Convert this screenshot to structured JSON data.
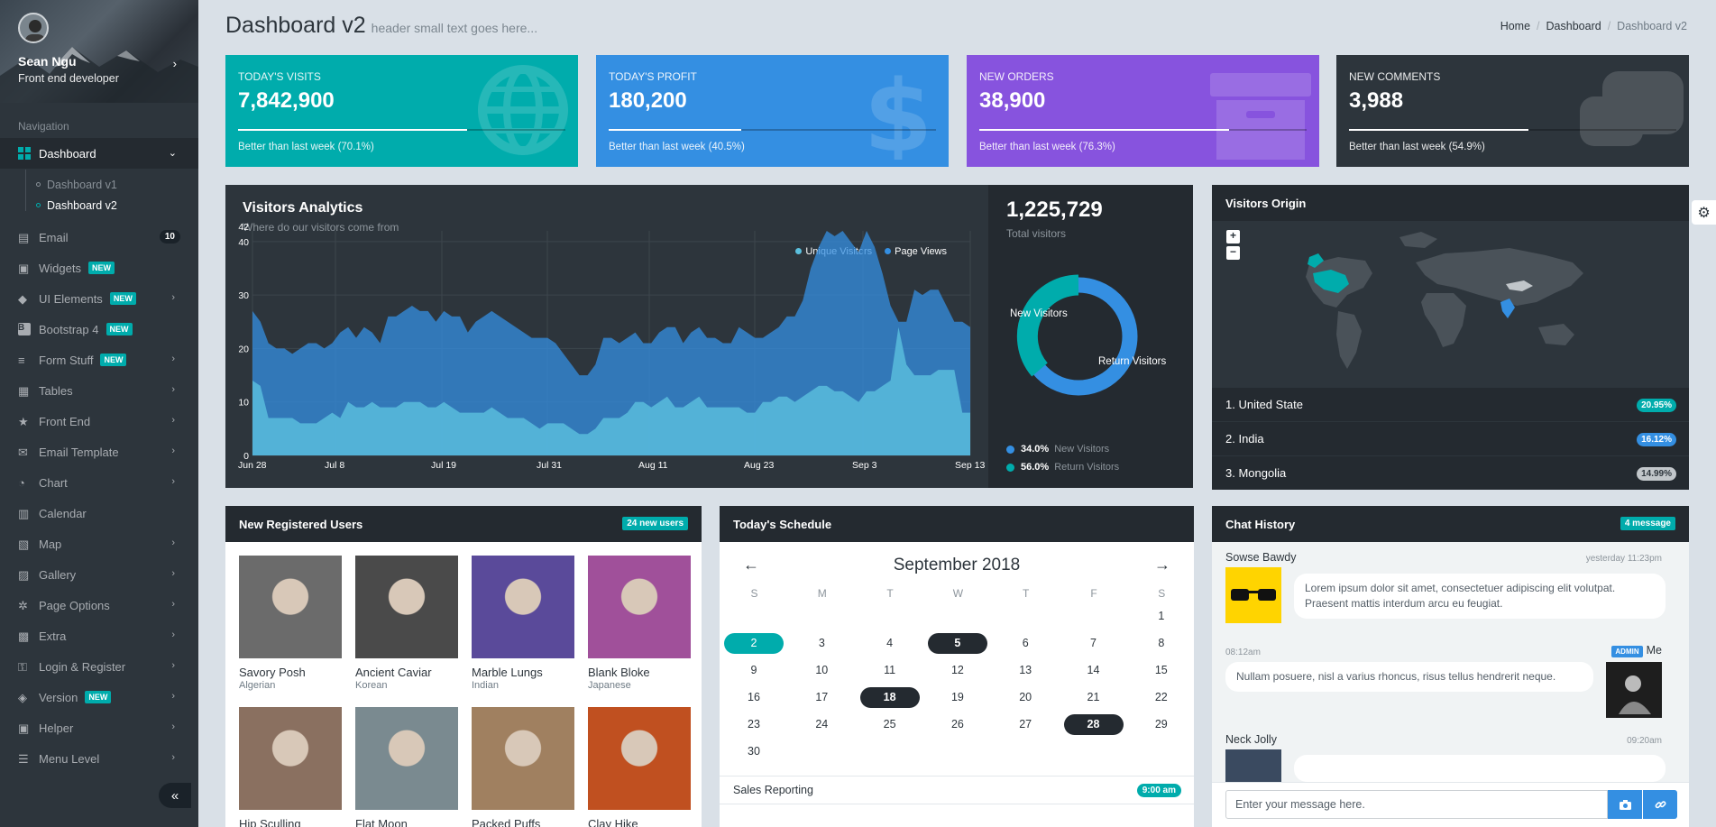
{
  "profile": {
    "name": "Sean Ngu",
    "role": "Front end developer"
  },
  "sidebar": {
    "nav_header": "Navigation",
    "dashboard": {
      "label": "Dashboard",
      "sub": [
        "Dashboard v1",
        "Dashboard v2"
      ]
    },
    "items": [
      {
        "label": "Email",
        "icon": "inbox-icon",
        "count": "10"
      },
      {
        "label": "Widgets",
        "icon": "widgets-icon",
        "badge": "NEW"
      },
      {
        "label": "UI Elements",
        "icon": "gem-icon",
        "badge": "NEW"
      },
      {
        "label": "Bootstrap 4",
        "icon": "bootstrap-icon",
        "badge": "NEW"
      },
      {
        "label": "Form Stuff",
        "icon": "list-icon",
        "badge": "NEW"
      },
      {
        "label": "Tables",
        "icon": "table-icon"
      },
      {
        "label": "Front End",
        "icon": "star-icon"
      },
      {
        "label": "Email Template",
        "icon": "envelope-icon"
      },
      {
        "label": "Chart",
        "icon": "pie-chart-icon"
      },
      {
        "label": "Calendar",
        "icon": "calendar-icon"
      },
      {
        "label": "Map",
        "icon": "map-icon"
      },
      {
        "label": "Gallery",
        "icon": "image-icon"
      },
      {
        "label": "Page Options",
        "icon": "cogs-icon"
      },
      {
        "label": "Extra",
        "icon": "gift-icon"
      },
      {
        "label": "Login & Register",
        "icon": "key-icon"
      },
      {
        "label": "Version",
        "icon": "cubes-icon",
        "badge": "NEW"
      },
      {
        "label": "Helper",
        "icon": "medkit-icon"
      },
      {
        "label": "Menu Level",
        "icon": "menu-icon"
      }
    ]
  },
  "header": {
    "title": "Dashboard v2",
    "subtitle": "header small text goes here...",
    "breadcrumb": [
      "Home",
      "Dashboard",
      "Dashboard v2"
    ]
  },
  "stats": [
    {
      "label": "TODAY'S VISITS",
      "value": "7,842,900",
      "progress": 0.701,
      "desc": "Better than last week (70.1%)",
      "icon": "globe-icon",
      "color": "#00acac"
    },
    {
      "label": "TODAY'S PROFIT",
      "value": "180,200",
      "progress": 0.405,
      "desc": "Better than last week (40.5%)",
      "icon": "dollar-icon",
      "color": "#348fe2"
    },
    {
      "label": "NEW ORDERS",
      "value": "38,900",
      "progress": 0.763,
      "desc": "Better than last week (76.3%)",
      "icon": "archive-icon",
      "color": "#8753de"
    },
    {
      "label": "NEW COMMENTS",
      "value": "3,988",
      "progress": 0.549,
      "desc": "Better than last week (54.9%)",
      "icon": "comments-icon",
      "color": "#2d353c"
    }
  ],
  "analytics": {
    "title": "Visitors Analytics",
    "subtitle": "Where do our visitors come from",
    "total": "1,225,729",
    "total_label": "Total visitors",
    "donut_labels": [
      "New Visitors",
      "Return Visitors"
    ],
    "legend": [
      {
        "pct": "34.0%",
        "label": "New Visitors",
        "color": "#348fe2"
      },
      {
        "pct": "56.0%",
        "label": "Return Visitors",
        "color": "#00acac"
      }
    ]
  },
  "chart_data": {
    "type": "area",
    "title": "",
    "ylim": [
      0,
      42
    ],
    "yticks": [
      "0",
      "10",
      "20",
      "30",
      "40",
      "42"
    ],
    "xticks": [
      "Jun 28",
      "Jul 8",
      "Jul 19",
      "Jul 31",
      "Aug 11",
      "Aug 23",
      "Sep 3",
      "Sep 13"
    ],
    "series": [
      {
        "name": "Page Views",
        "color": "#348fe2",
        "values": [
          27,
          25,
          21,
          20,
          20,
          19,
          20,
          21,
          21,
          20,
          21,
          23,
          24,
          22,
          24,
          23,
          21,
          26,
          26,
          27,
          28,
          27,
          27,
          25,
          27,
          26,
          26,
          23,
          25,
          26,
          27,
          26,
          25,
          24,
          23,
          22,
          22,
          22,
          21,
          19,
          17,
          15,
          15,
          17,
          22,
          22,
          21,
          22,
          23,
          21,
          21,
          23,
          24,
          24,
          21,
          23,
          24,
          22,
          22,
          21,
          21,
          24,
          23,
          22,
          22,
          23,
          24,
          26,
          26,
          29,
          35,
          39,
          42,
          41,
          42,
          40,
          38,
          42,
          39,
          34,
          28,
          25,
          25,
          31,
          30,
          31,
          31,
          28,
          25,
          25,
          24
        ]
      },
      {
        "name": "Unique Visitors",
        "color": "#5bc0de",
        "values": [
          14,
          13,
          7,
          7,
          7,
          7,
          6,
          6,
          6,
          7,
          8,
          7,
          10,
          9,
          9,
          10,
          9,
          9,
          9,
          10,
          10,
          10,
          9,
          9,
          10,
          9,
          8,
          8,
          8,
          8,
          9,
          8,
          7,
          7,
          7,
          6,
          5,
          6,
          6,
          6,
          5,
          4,
          4,
          5,
          7,
          7,
          7,
          8,
          10,
          10,
          9,
          10,
          11,
          9,
          9,
          10,
          11,
          9,
          9,
          9,
          9,
          9,
          8,
          8,
          10,
          10,
          11,
          11,
          10,
          11,
          12,
          13,
          13,
          12,
          12,
          11,
          10,
          12,
          12,
          13,
          14,
          24,
          17,
          15,
          15,
          15,
          16,
          16,
          16,
          8,
          8
        ]
      }
    ]
  },
  "origin": {
    "title": "Visitors Origin",
    "zoom_in": "+",
    "zoom_out": "−",
    "countries": [
      {
        "name": "1. United State",
        "pct": "20.95%",
        "color": "#00acac"
      },
      {
        "name": "2. India",
        "pct": "16.12%",
        "color": "#348fe2"
      },
      {
        "name": "3. Mongolia",
        "pct": "14.99%",
        "color": "#c1c6ca"
      }
    ]
  },
  "users": {
    "title": "New Registered Users",
    "badge": "24 new users",
    "list": [
      {
        "name": "Savory Posh",
        "country": "Algerian",
        "tone": "#6b6b6b"
      },
      {
        "name": "Ancient Caviar",
        "country": "Korean",
        "tone": "#4a4a4a"
      },
      {
        "name": "Marble Lungs",
        "country": "Indian",
        "tone": "#5a4a9a"
      },
      {
        "name": "Blank Bloke",
        "country": "Japanese",
        "tone": "#a0509a"
      },
      {
        "name": "Hip Sculling",
        "country": "",
        "tone": "#8a7060"
      },
      {
        "name": "Flat Moon",
        "country": "",
        "tone": "#7a8a90"
      },
      {
        "name": "Packed Puffs",
        "country": "",
        "tone": "#a08060"
      },
      {
        "name": "Clay Hike",
        "country": "",
        "tone": "#c05020"
      }
    ]
  },
  "schedule": {
    "title": "Today's Schedule",
    "month": "September 2018",
    "dow": [
      "S",
      "M",
      "T",
      "W",
      "T",
      "F",
      "S"
    ],
    "rows": [
      [
        "",
        "",
        "",
        "",
        "",
        "",
        "1"
      ],
      [
        "2",
        "3",
        "4",
        "5",
        "6",
        "7",
        "8"
      ],
      [
        "9",
        "10",
        "11",
        "12",
        "13",
        "14",
        "15"
      ],
      [
        "16",
        "17",
        "18",
        "19",
        "20",
        "21",
        "22"
      ],
      [
        "23",
        "24",
        "25",
        "26",
        "27",
        "28",
        "29"
      ],
      [
        "30",
        "",
        "",
        "",
        "",
        "",
        ""
      ]
    ],
    "today": "2",
    "highlighted": [
      "5",
      "18",
      "28"
    ],
    "events": [
      {
        "title": "Sales Reporting",
        "time": "9:00 am",
        "color": "#00acac"
      }
    ]
  },
  "chat": {
    "title": "Chat History",
    "badge": "4 message",
    "messages": [
      {
        "name": "Sowse Bawdy",
        "time": "yesterday 11:23pm",
        "text": "Lorem ipsum dolor sit amet, consectetuer adipiscing elit volutpat. Praesent mattis interdum arcu eu feugiat."
      },
      {
        "name": "Me",
        "time": "08:12am",
        "badge": "ADMIN",
        "text": "Nullam posuere, nisl a varius rhoncus, risus tellus hendrerit neque."
      },
      {
        "name": "Neck Jolly",
        "time": "09:20am",
        "text": ""
      }
    ],
    "placeholder": "Enter your message here."
  }
}
